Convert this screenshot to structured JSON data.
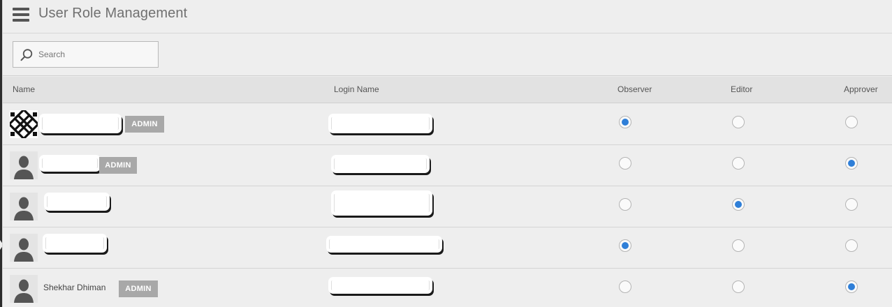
{
  "header": {
    "title": "User Role Management"
  },
  "search": {
    "placeholder": "Search"
  },
  "columns": {
    "name": "Name",
    "login": "Login Name",
    "observer": "Observer",
    "editor": "Editor",
    "approver": "Approver"
  },
  "rows": [
    {
      "name": "",
      "admin_badge": "ADMIN",
      "role": "observer",
      "avatar": "decorative-knot-avatar"
    },
    {
      "name": "",
      "admin_badge": "ADMIN",
      "role": "approver",
      "avatar": "person-silhouette-avatar"
    },
    {
      "name": "",
      "admin_badge": "",
      "role": "editor",
      "avatar": "person-silhouette-avatar"
    },
    {
      "name": "",
      "admin_badge": "",
      "role": "observer",
      "avatar": "person-silhouette-avatar"
    },
    {
      "name": "Shekhar Dhiman",
      "admin_badge": "ADMIN",
      "role": "approver",
      "avatar": "person-silhouette-avatar"
    }
  ],
  "colors": {
    "accent": "#2f7fd8",
    "badge": "#a8a8a8",
    "background": "#eeeeee"
  }
}
